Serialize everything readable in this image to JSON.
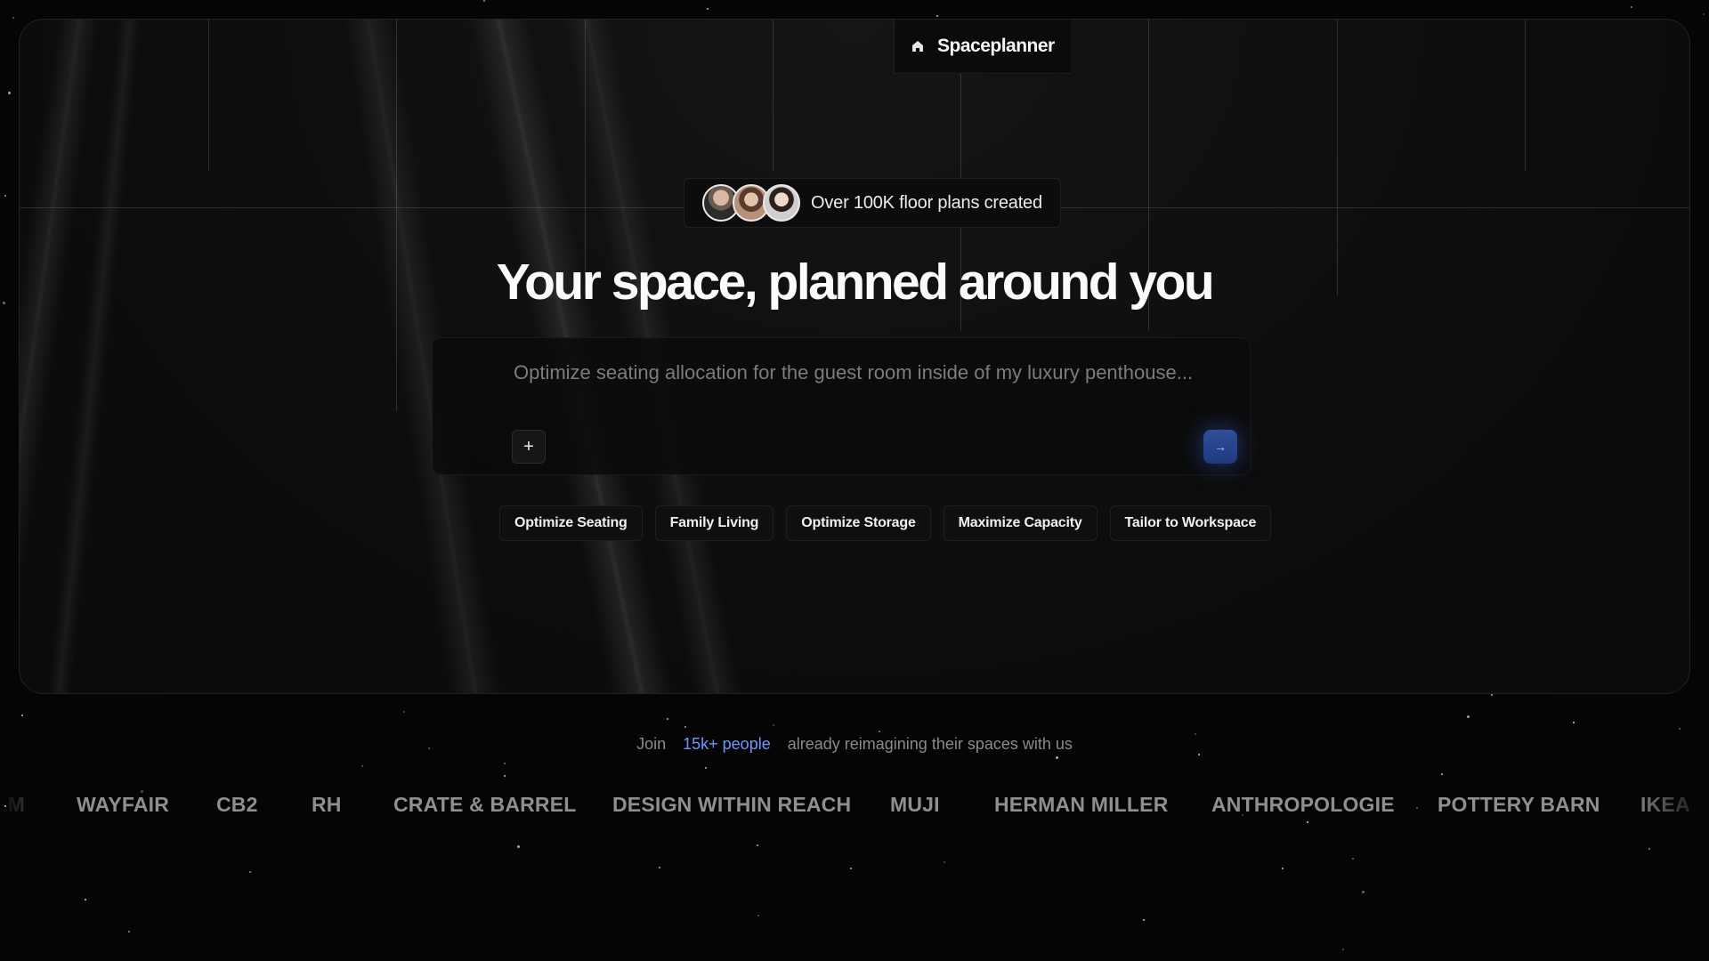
{
  "header": {
    "brand_name": "Spaceplanner",
    "brand_icon": "home-icon"
  },
  "social_proof": {
    "text": "Over 100K floor plans created",
    "avatar_count": 3
  },
  "hero": {
    "headline": "Your space, planned around you"
  },
  "prompt": {
    "placeholder": "Optimize seating allocation for the guest room inside of my luxury penthouse...",
    "value": "",
    "add_label": "+",
    "send_icon": "arrow-right-icon",
    "send_label": "→"
  },
  "chips": [
    {
      "label": "Optimize Seating"
    },
    {
      "label": "Family Living"
    },
    {
      "label": "Optimize Storage"
    },
    {
      "label": "Maximize Capacity"
    },
    {
      "label": "Tailor to Workspace"
    }
  ],
  "join": {
    "prefix": "Join",
    "highlight": "15k+ people",
    "suffix": "already reimagining their spaces with us"
  },
  "brands": [
    {
      "name": "WEST ELM"
    },
    {
      "name": "WAYFAIR"
    },
    {
      "name": "CB2"
    },
    {
      "name": "RH"
    },
    {
      "name": "CRATE & BARREL"
    },
    {
      "name": "DESIGN WITHIN REACH"
    },
    {
      "name": "MUJI"
    },
    {
      "name": "HERMAN MILLER"
    },
    {
      "name": "ANTHROPOLOGIE"
    },
    {
      "name": "POTTERY BARN"
    },
    {
      "name": "IKEA"
    }
  ],
  "colors": {
    "accent": "#6f96ff",
    "send_button": "#2f4f9a",
    "background": "#050505"
  }
}
